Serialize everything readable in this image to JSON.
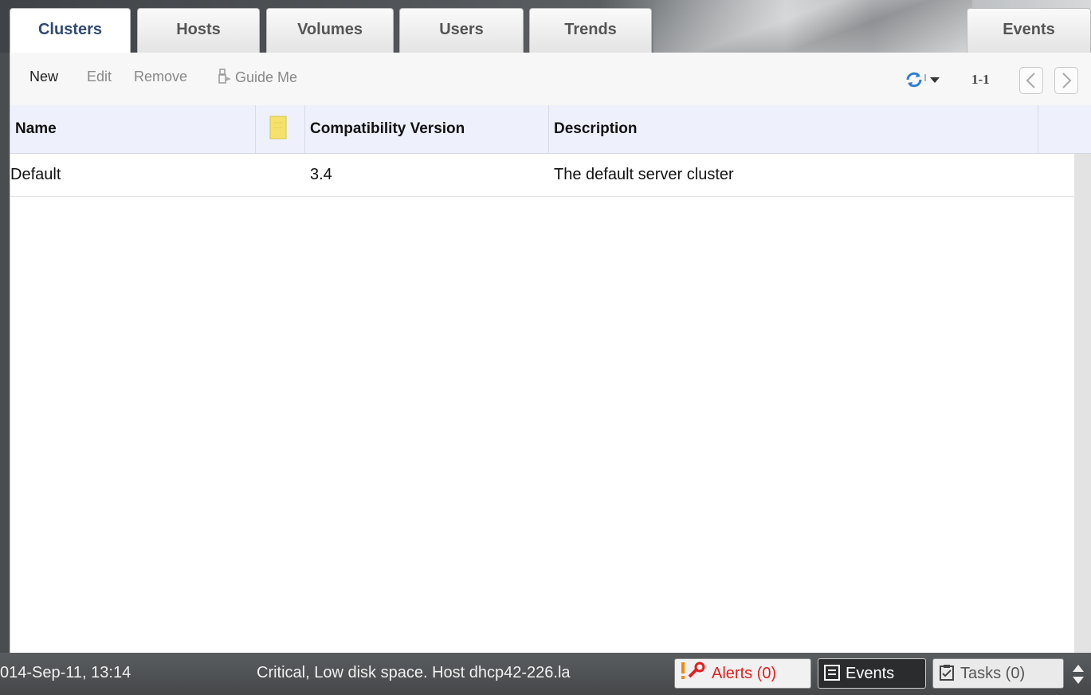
{
  "tabs": [
    {
      "label": "Clusters"
    },
    {
      "label": "Hosts"
    },
    {
      "label": "Volumes"
    },
    {
      "label": "Users"
    },
    {
      "label": "Trends"
    },
    {
      "label": "Events"
    }
  ],
  "toolbar": {
    "new_label": "New",
    "edit_label": "Edit",
    "remove_label": "Remove",
    "guide_label": "Guide Me",
    "pager_text": "1-1"
  },
  "grid": {
    "columns": [
      "Name",
      "",
      "Compatibility Version",
      "Description"
    ],
    "rows": [
      {
        "name": "Default",
        "compat": "3.4",
        "desc": "The default server cluster"
      }
    ]
  },
  "statusbar": {
    "time": "014-Sep-11, 13:14",
    "message": "Critical, Low disk space. Host dhcp42-226.la",
    "alerts_label": "Alerts (0)",
    "events_label": "Events",
    "tasks_label": "Tasks (0)"
  },
  "colors": {
    "active_tab_text": "#2f4a73",
    "alert_red": "#e02020",
    "header_bg": "#eef1fb"
  }
}
